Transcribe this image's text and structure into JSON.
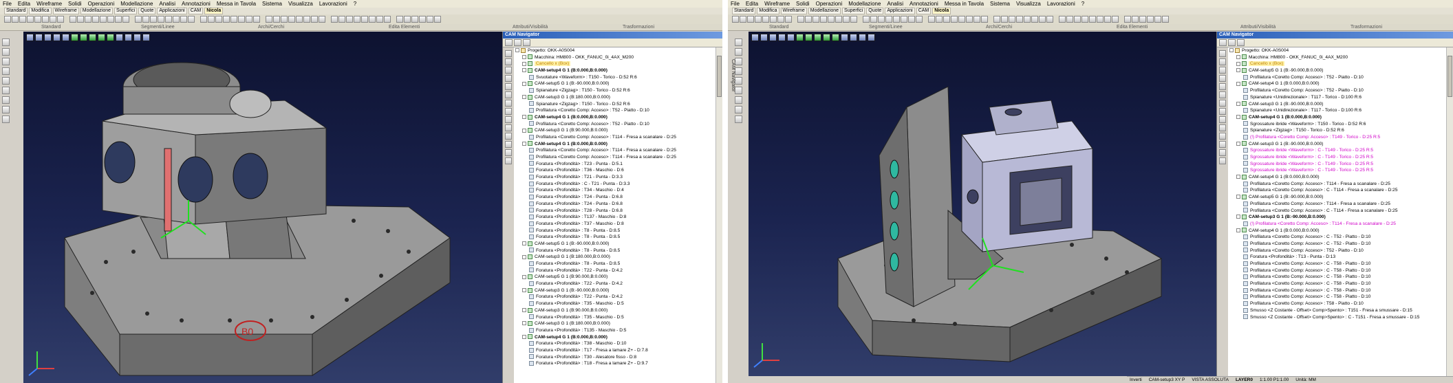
{
  "menu": [
    "File",
    "Edita",
    "Wireframe",
    "Solidi",
    "Operazioni",
    "Modellazione",
    "Analisi",
    "Annotazioni",
    "Messa in Tavola",
    "Sistema",
    "Visualizza",
    "Lavorazioni",
    "?"
  ],
  "tabs": [
    "Standard",
    "Modifica",
    "Wireframe",
    "Modellazione",
    "Superfici",
    "Quote",
    "Applicazioni",
    "CAM",
    "Nicola"
  ],
  "groups": [
    "Standard",
    "Segmenti/Linee",
    "Archi/Cerchi",
    "Edita Elementi",
    "Attributi/Visibilità",
    "Trasformazioni"
  ],
  "left": {
    "nav_title": "CAM Navigator",
    "tree": [
      {
        "text": "Progetto: OKK-A0S004",
        "lv": 0,
        "style": ""
      },
      {
        "text": "Macchina: HM800 - OKK_FANUC_0i_4AX_M200",
        "lv": 1,
        "style": ""
      },
      {
        "text": "Cancello x (Box)",
        "lv": 1,
        "style": "hl"
      },
      {
        "text": "CAM-setup4 G 1 (B:0.000,B:0.000)",
        "lv": 1,
        "style": "bold"
      },
      {
        "text": "Svuotature <Waveform> : T150 - Torico - D:52 R:6",
        "lv": 2,
        "style": ""
      },
      {
        "text": "CAM-setup5 G 1 (B:-90.000,B:0.000)",
        "lv": 1,
        "style": ""
      },
      {
        "text": "Spianature <Zigzag> : T150 - Torico - D:52 R:6",
        "lv": 2,
        "style": ""
      },
      {
        "text": "CAM-setup3 G 1 (B:180.000,B:0.000)",
        "lv": 1,
        "style": ""
      },
      {
        "text": "Spianature <Zigzag> : T150 - Torico - D:52 R:6",
        "lv": 2,
        "style": ""
      },
      {
        "text": "Profilatura <Coretto Comp: Acceso> : T52 - Piatto - D:10",
        "lv": 2,
        "style": ""
      },
      {
        "text": "CAM-setup4 G 1 (B:0.000,B:0.000)",
        "lv": 1,
        "style": "bold"
      },
      {
        "text": "Profilatura <Coretto Comp: Acceso> : T52 - Piatto - D:10",
        "lv": 2,
        "style": ""
      },
      {
        "text": "CAM-setup3 G 1 (B:90.000,B:0.000)",
        "lv": 1,
        "style": ""
      },
      {
        "text": "Profilatura <Coretto Comp: Acceso> : T114 - Fresa a scanalare - D:25",
        "lv": 2,
        "style": ""
      },
      {
        "text": "CAM-setup4 G 1 (B:0.000,B:0.000)",
        "lv": 1,
        "style": "bold"
      },
      {
        "text": "Profilatura <Coretto Comp: Acceso> : T114 - Fresa a scanalare - D:25",
        "lv": 2,
        "style": ""
      },
      {
        "text": "Profilatura <Coretto Comp: Acceso> : T114 - Fresa a scanalare - D:25",
        "lv": 2,
        "style": ""
      },
      {
        "text": "Foratura <Profondità> : T23 - Punta - D:5.1",
        "lv": 2,
        "style": ""
      },
      {
        "text": "Foratura <Profondità> : T36 - Maschio - D:6",
        "lv": 2,
        "style": ""
      },
      {
        "text": "Foratura <Profondità> : T21 - Punta - D:3.3",
        "lv": 2,
        "style": ""
      },
      {
        "text": "Foratura <Profondità> : C - T21 - Punta - D:3.3",
        "lv": 2,
        "style": ""
      },
      {
        "text": "Foratura <Profondità> : T34 - Maschio - D:4",
        "lv": 2,
        "style": ""
      },
      {
        "text": "Foratura <Profondità> : T24 - Punta - D:6.8",
        "lv": 2,
        "style": ""
      },
      {
        "text": "Foratura <Profondità> : T24 - Punta - D:6.8",
        "lv": 2,
        "style": ""
      },
      {
        "text": "Foratura <Profondità> : T28 - Punta - D:6.8",
        "lv": 2,
        "style": ""
      },
      {
        "text": "Foratura <Profondità> : T137 - Maschio - D:8",
        "lv": 2,
        "style": ""
      },
      {
        "text": "Foratura <Profondità> : T37 - Maschio - D:8",
        "lv": 2,
        "style": ""
      },
      {
        "text": "Foratura <Profondità> : T8 - Punta - D:8.5",
        "lv": 2,
        "style": ""
      },
      {
        "text": "Foratura <Profondità> : T8 - Punta - D:8.5",
        "lv": 2,
        "style": ""
      },
      {
        "text": "CAM-setup5 G 1 (B:-90.000,B:0.000)",
        "lv": 1,
        "style": ""
      },
      {
        "text": "Foratura <Profondità> : T8 - Punta - D:8.5",
        "lv": 2,
        "style": ""
      },
      {
        "text": "CAM-setup3 G 1 (B:180.000,B:0.000)",
        "lv": 1,
        "style": ""
      },
      {
        "text": "Foratura <Profondità> : T8 - Punta - D:8.5",
        "lv": 2,
        "style": ""
      },
      {
        "text": "Foratura <Profondità> : T22 - Punta - D:4.2",
        "lv": 2,
        "style": ""
      },
      {
        "text": "CAM-setup5 G 1 (B:90.000,B:0.000)",
        "lv": 1,
        "style": ""
      },
      {
        "text": "Foratura <Profondità> : T22 - Punta - D:4.2",
        "lv": 2,
        "style": ""
      },
      {
        "text": "CAM-setup3 G 1 (B:-90.000,B:0.000)",
        "lv": 1,
        "style": ""
      },
      {
        "text": "Foratura <Profondità> : T22 - Punta - D:4.2",
        "lv": 2,
        "style": ""
      },
      {
        "text": "Foratura <Profondità> : T35 - Maschio - D:5",
        "lv": 2,
        "style": ""
      },
      {
        "text": "CAM-setup3 G 1 (B:90.000,B:0.000)",
        "lv": 1,
        "style": ""
      },
      {
        "text": "Foratura <Profondità> : T35 - Maschio - D:5",
        "lv": 2,
        "style": ""
      },
      {
        "text": "CAM-setup3 G 1 (B:180.000,B:0.000)",
        "lv": 1,
        "style": ""
      },
      {
        "text": "Foratura <Profondità> : T135 - Maschio - D:5",
        "lv": 2,
        "style": ""
      },
      {
        "text": "CAM-setup4 G 1 (B:0.000,B:0.000)",
        "lv": 1,
        "style": "bold"
      },
      {
        "text": "Foratura <Profondità> : T38 - Maschio - D:10",
        "lv": 2,
        "style": ""
      },
      {
        "text": "Foratura <Profondità> : T17 - Fresa a lamare Z+ - D:7.8",
        "lv": 2,
        "style": ""
      },
      {
        "text": "Foratura <Profondità> : T30 - Alesatore fisso - D:8",
        "lv": 2,
        "style": ""
      },
      {
        "text": "Foratura <Profondità> : T18 - Fresa a lamare Z+ - D:9.7",
        "lv": 2,
        "style": ""
      }
    ],
    "viewport_label": "B0"
  },
  "right": {
    "nav_title": "CAM Navigator",
    "tree": [
      {
        "text": "Progetto: OKK-A0S004",
        "lv": 0,
        "style": ""
      },
      {
        "text": "Macchina: HM800 - OKK_FANUC_0i_4AX_M200",
        "lv": 1,
        "style": ""
      },
      {
        "text": "Cancello x (Box)",
        "lv": 1,
        "style": "hl"
      },
      {
        "text": "CAM-setup5 G 1 (B:-90.000,B:0.000)",
        "lv": 1,
        "style": ""
      },
      {
        "text": "Profilatura <Coretto Comp: Acceso> : T52 - Piatto - D:10",
        "lv": 2,
        "style": ""
      },
      {
        "text": "CAM-setup4 G 1 (B:0.000,B:0.000)",
        "lv": 1,
        "style": ""
      },
      {
        "text": "Profilatura <Coretto Comp: Acceso> : T52 - Piatto - D:10",
        "lv": 2,
        "style": ""
      },
      {
        "text": "Spianature <Unidirezionale> : T117 - Torico - D:100 R:6",
        "lv": 2,
        "style": ""
      },
      {
        "text": "CAM-setup3 G 1 (B:-90.000,B:0.000)",
        "lv": 1,
        "style": ""
      },
      {
        "text": "Spianature <Unidirezionale> : T117 - Torico - D:100 R:6",
        "lv": 2,
        "style": ""
      },
      {
        "text": "CAM-setup4 G 1 (B:0.000,B:0.000)",
        "lv": 1,
        "style": "bold"
      },
      {
        "text": "Sgrossature ibride <Waveform> : T150 - Torico - D:52 R:6",
        "lv": 2,
        "style": ""
      },
      {
        "text": "Spianature <Zigzag> : T150 - Torico - D:52 R:6",
        "lv": 2,
        "style": ""
      },
      {
        "text": "(!) Profilatura <Coretto Comp: Acceso> : T149 - Torico - D:25 R:5",
        "lv": 2,
        "style": "magenta"
      },
      {
        "text": "CAM-setup3 G 1 (B:-90.000,B:0.000)",
        "lv": 1,
        "style": ""
      },
      {
        "text": "Sgrossature ibride <Waveform> : C - T149 - Torico - D:25 R:5",
        "lv": 2,
        "style": "magenta"
      },
      {
        "text": "Sgrossature ibride <Waveform> : C - T149 - Torico - D:25 R:5",
        "lv": 2,
        "style": "magenta"
      },
      {
        "text": "Sgrossature ibride <Waveform> : C - T149 - Torico - D:25 R:5",
        "lv": 2,
        "style": "magenta"
      },
      {
        "text": "Sgrossature ibride <Waveform> : C - T149 - Torico - D:25 R:5",
        "lv": 2,
        "style": "magenta"
      },
      {
        "text": "CAM-setup4 G 1 (B:0.000,B:0.000)",
        "lv": 1,
        "style": ""
      },
      {
        "text": "Profilatura <Coretto Comp: Acceso> : T114 - Fresa a scanalare - D:25",
        "lv": 2,
        "style": ""
      },
      {
        "text": "Profilatura <Coretto Comp: Acceso> : C - T114 - Fresa a scanalare - D:25",
        "lv": 2,
        "style": ""
      },
      {
        "text": "CAM-setup5 G 1 (B:-90.000,B:0.000)",
        "lv": 1,
        "style": ""
      },
      {
        "text": "Profilatura <Coretto Comp: Acceso> : T114 - Fresa a scanalare - D:25",
        "lv": 2,
        "style": ""
      },
      {
        "text": "Profilatura <Coretto Comp: Acceso> : C - T114 - Fresa a scanalare - D:25",
        "lv": 2,
        "style": ""
      },
      {
        "text": "CAM-setup3 G 1 (B:-90.000,B:0.000)",
        "lv": 1,
        "style": "bold"
      },
      {
        "text": "(!) Profilatura <Coretto Comp: Acceso> : T114 - Fresa a scanalare - D:25",
        "lv": 2,
        "style": "magenta"
      },
      {
        "text": "CAM-setup4 G 1 (B:0.000,B:0.000)",
        "lv": 1,
        "style": ""
      },
      {
        "text": "Profilatura <Coretto Comp: Acceso> : C - T52 - Piatto - D:10",
        "lv": 2,
        "style": ""
      },
      {
        "text": "Profilatura <Coretto Comp: Acceso> : C - T52 - Piatto - D:10",
        "lv": 2,
        "style": ""
      },
      {
        "text": "Profilatura <Coretto Comp: Acceso> : T52 - Piatto - D:10",
        "lv": 2,
        "style": ""
      },
      {
        "text": "Foratura <Profondità> : T13 - Punta - D:13",
        "lv": 2,
        "style": ""
      },
      {
        "text": "Profilatura <Coretto Comp: Acceso> : C - T58 - Piatto - D:10",
        "lv": 2,
        "style": ""
      },
      {
        "text": "Profilatura <Coretto Comp: Acceso> : C - T58 - Piatto - D:10",
        "lv": 2,
        "style": ""
      },
      {
        "text": "Profilatura <Coretto Comp: Acceso> : C - T58 - Piatto - D:10",
        "lv": 2,
        "style": ""
      },
      {
        "text": "Profilatura <Coretto Comp: Acceso> : C - T58 - Piatto - D:10",
        "lv": 2,
        "style": ""
      },
      {
        "text": "Profilatura <Coretto Comp: Acceso> : C - T58 - Piatto - D:10",
        "lv": 2,
        "style": ""
      },
      {
        "text": "Profilatura <Coretto Comp: Acceso> : C - T58 - Piatto - D:10",
        "lv": 2,
        "style": ""
      },
      {
        "text": "Profilatura <Coretto Comp: Acceso> : T58 - Piatto - D:10",
        "lv": 2,
        "style": ""
      },
      {
        "text": "Smusso <Z Costante - Offset> Comp>Spento> : T151 - Fresa a smussare - D:15",
        "lv": 2,
        "style": ""
      },
      {
        "text": "Smusso <Z Costante - Offset> Comp>Spento> : C - T151 - Fresa a smussare - D:15",
        "lv": 2,
        "style": ""
      }
    ],
    "status": [
      "Inverti",
      "CAM-setup3 XY P",
      "VISTA ASSOLUTA",
      "LAYER0",
      "1:1.00 P1:1.00",
      "Unità: MM"
    ]
  }
}
